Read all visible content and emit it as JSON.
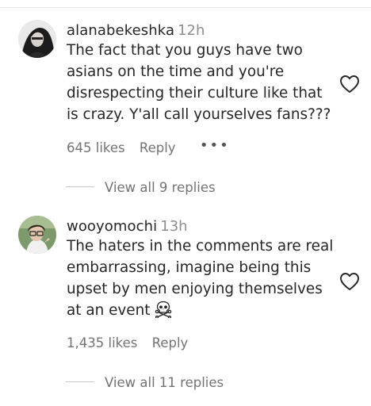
{
  "comments": [
    {
      "username": "alanabekeshka",
      "time": "12h",
      "text": "The fact that you guys have two\nasians on the time and you're\ndisrespecting their culture like that\nis crazy. Y'all call yourselves fans???",
      "likes": "645 likes",
      "reply_label": "Reply",
      "more_label": "•••",
      "view_replies": "View all 9 replies",
      "avatar_icon": "profile-photo",
      "heart_icon": "heart-outline-icon"
    },
    {
      "username": "wooyomochi",
      "time": "13h",
      "text": "The haters in the comments are real\nembarrassing, imagine being this\nupset by men enjoying themselves\nat an event",
      "emoji": "skull-and-crossbones",
      "likes": "1,435 likes",
      "reply_label": "Reply",
      "view_replies": "View all 11 replies",
      "avatar_icon": "profile-photo",
      "heart_icon": "heart-outline-icon"
    }
  ],
  "colors": {
    "text": "#262626",
    "secondary": "#737373",
    "divider": "#c7c7c7"
  }
}
